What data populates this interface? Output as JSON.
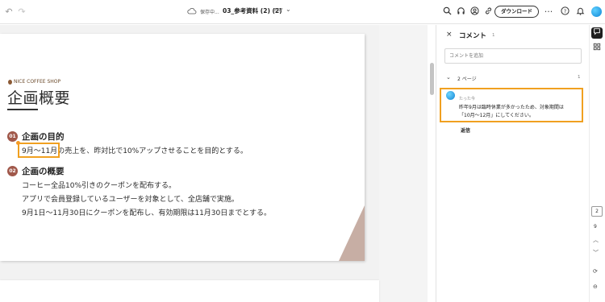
{
  "toolbar": {
    "save_state": "保存中...",
    "doc_title": "03_参考資料 (2) (2)",
    "doc_type": "PDF",
    "download_label": "ダウンロード"
  },
  "document": {
    "brand": "NICE COFFEE SHOP",
    "heading": "企画概要",
    "sections": [
      {
        "number": "01",
        "title": "企画の目的"
      },
      {
        "number": "02",
        "title": "企画の概要"
      }
    ],
    "highlight_text": "9月～11月",
    "sec1_line_rest": "の売上を、昨対比で10%アップさせることを目的とする。",
    "sec2_lines": [
      "コーヒー全品10%引きのクーポンを配布する。",
      "アプリで会員登録しているユーザーを対象として、全店舗で実施。",
      "9月1日～11月30日にクーポンを配布し、有効期限は11月30日までとする。"
    ]
  },
  "comments": {
    "title": "コメント",
    "count": "1",
    "input_placeholder": "コメントを追加",
    "group_label": "2 ページ",
    "group_count": "1",
    "item": {
      "time": "たった今",
      "lines": [
        "昨年9月は臨時休業が多かったため、対象期間は",
        "「10月～12月」にしてください。"
      ],
      "reply_label": "返信"
    }
  },
  "rail": {
    "page_current": "2",
    "page_total": "9"
  },
  "colors": {
    "highlight": "#f0a020",
    "badge": "#a0584a",
    "deco": "#c7aea4",
    "avatar": "#1184d4"
  },
  "icons": [
    "undo-icon",
    "redo-icon",
    "cloud-icon",
    "chevron-down-icon",
    "search-icon",
    "headphones-icon",
    "account-icon",
    "link-icon",
    "more-icon",
    "help-icon",
    "bell-icon",
    "comment-icon",
    "grid-icon",
    "close-icon",
    "chevron-up-icon",
    "zoom-icon"
  ]
}
